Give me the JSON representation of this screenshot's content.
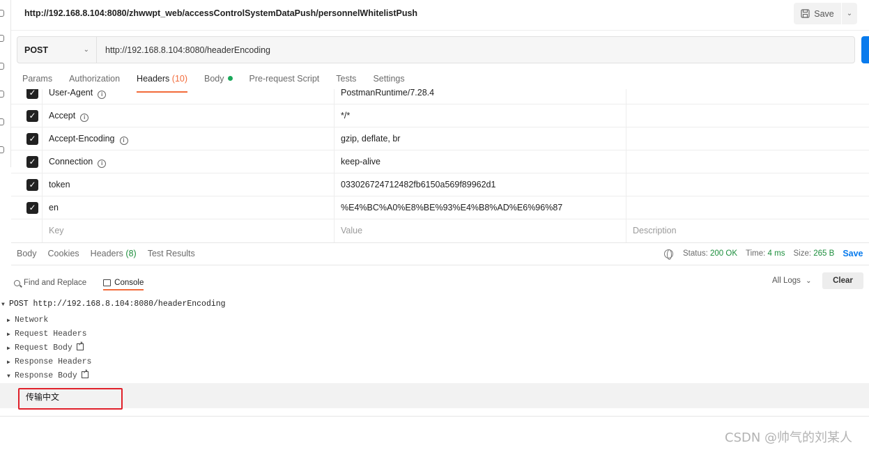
{
  "request_title": "http://192.168.8.104:8080/zhwwpt_web/accessControlSystemDataPush/personnelWhitelistPush",
  "save": {
    "label": "Save"
  },
  "urlbar": {
    "method": "POST",
    "url": "http://192.168.8.104:8080/headerEncoding"
  },
  "request_tabs": [
    {
      "label": "Params"
    },
    {
      "label": "Authorization"
    },
    {
      "label": "Headers",
      "count": "(10)"
    },
    {
      "label": "Body"
    },
    {
      "label": "Pre-request Script"
    },
    {
      "label": "Tests"
    },
    {
      "label": "Settings"
    }
  ],
  "headers": [
    {
      "key": "User-Agent",
      "value": "PostmanRuntime/7.28.4"
    },
    {
      "key": "Accept",
      "value": "*/*"
    },
    {
      "key": "Accept-Encoding",
      "value": "gzip, deflate, br"
    },
    {
      "key": "Connection",
      "value": "keep-alive"
    },
    {
      "key": "token",
      "value": "033026724712482fb6150a569f89962d1"
    },
    {
      "key": "en",
      "value": "%E4%BC%A0%E8%BE%93%E4%B8%AD%E6%96%87"
    }
  ],
  "header_placeholders": {
    "key": "Key",
    "value": "Value",
    "description": "Description"
  },
  "response_tabs": [
    {
      "label": "Body"
    },
    {
      "label": "Cookies"
    },
    {
      "label": "Headers",
      "count": "(8)"
    },
    {
      "label": "Test Results"
    }
  ],
  "response_stats": {
    "status_label": "Status:",
    "status_value": "200 OK",
    "time_label": "Time:",
    "time_value": "4 ms",
    "size_label": "Size:",
    "size_value": "265 B",
    "save_label": "Save"
  },
  "console": {
    "tabs": [
      {
        "label": "Find and Replace"
      },
      {
        "label": "Console"
      }
    ],
    "log_filter": "All Logs",
    "clear_label": "Clear",
    "entry": "POST http://192.168.8.104:8080/headerEncoding",
    "sections": [
      "Network",
      "Request Headers",
      "Request Body",
      "Response Headers",
      "Response Body"
    ],
    "response_body": "传输中文"
  },
  "watermark": "CSDN @帅气的刘某人",
  "colors": {
    "accent": "#f26b3a",
    "success": "#1c8e3c",
    "primary": "#097bed",
    "highlight": "#e0202a"
  }
}
